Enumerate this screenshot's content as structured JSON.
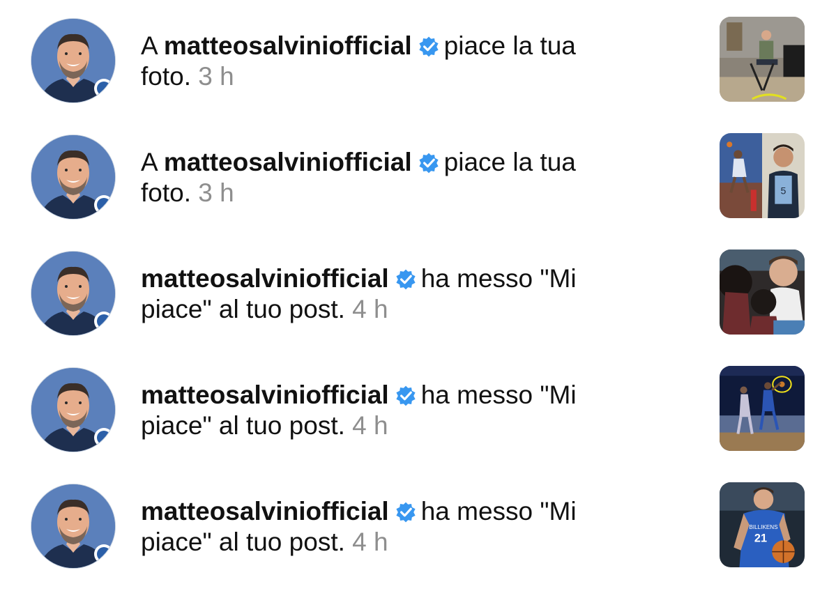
{
  "notifications": [
    {
      "prefix": "A",
      "username": "matteosalviniofficial",
      "action_line1": "piace la tua",
      "action_line2": "foto.",
      "time": "3 h",
      "thumbnail": "photo-man-at-desk"
    },
    {
      "prefix": "A",
      "username": "matteosalviniofficial",
      "action_line1": "piace la tua",
      "action_line2": "foto.",
      "time": "3 h",
      "thumbnail": "photo-dunk-and-kid-in-jersey"
    },
    {
      "prefix": "",
      "username": "matteosalviniofficial",
      "action_line1": "ha messo \"Mi",
      "action_line2": "piace\" al tuo post.",
      "time": "4 h",
      "thumbnail": "photo-player-crowd"
    },
    {
      "prefix": "",
      "username": "matteosalviniofficial",
      "action_line1": "ha messo \"Mi",
      "action_line2": "piace\" al tuo post.",
      "time": "4 h",
      "thumbnail": "photo-basketball-court-play"
    },
    {
      "prefix": "",
      "username": "matteosalviniofficial",
      "action_line1": "ha messo \"Mi",
      "action_line2": "piace\" al tuo post.",
      "time": "4 h",
      "thumbnail": "photo-billikens-21-player"
    }
  ],
  "colors": {
    "verified": "#3897f0",
    "time": "#8e8e8e",
    "avatar_bg": "#5b80bb"
  }
}
